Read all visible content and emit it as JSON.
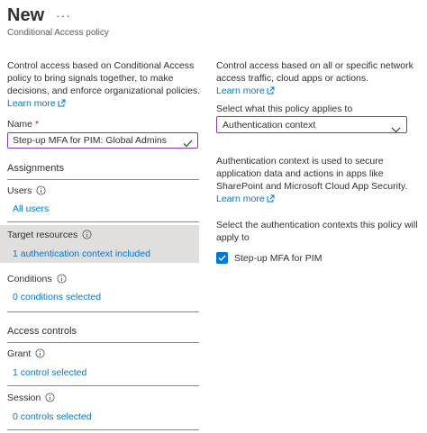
{
  "header": {
    "title": "New",
    "more_label": "···",
    "subtitle": "Conditional Access policy"
  },
  "left": {
    "intro_lines": [
      "Control access based on Conditional Access",
      "policy to bring signals together, to make",
      "decisions, and enforce organizational policies."
    ],
    "learn_more": "Learn more",
    "name_label": "Name",
    "required_marker": "*",
    "name_value": "Step-up MFA for PIM: Global Admins",
    "assignments_heading": "Assignments",
    "users": {
      "label": "Users",
      "value": "All users"
    },
    "target_resources": {
      "label": "Target resources",
      "value": "1 authentication context included"
    },
    "conditions": {
      "label": "Conditions",
      "value": "0 conditions selected"
    },
    "access_controls_heading": "Access controls",
    "grant": {
      "label": "Grant",
      "value": "1 control selected"
    },
    "session": {
      "label": "Session",
      "value": "0 controls selected"
    }
  },
  "right": {
    "intro_lines": [
      "Control access based on all or specific network",
      "access traffic, cloud apps or actions."
    ],
    "learn_more": "Learn more",
    "select_label": "Select what this policy applies to",
    "select_value": "Authentication context",
    "context_desc_lines": [
      "Authentication context is used to secure",
      "application data and actions in apps like",
      "SharePoint and Microsoft Cloud App Security."
    ],
    "learn_more_2": "Learn more",
    "apply_lines": [
      "Select the authentication contexts this policy will",
      "apply to"
    ],
    "checkbox_label": "Step-up MFA for PIM",
    "checkbox_checked": true
  },
  "colors": {
    "link": "#0078d4",
    "focus_border": "#8a3aa8",
    "highlight_bg": "#e1dfdd",
    "valid_check": "#107c10"
  }
}
